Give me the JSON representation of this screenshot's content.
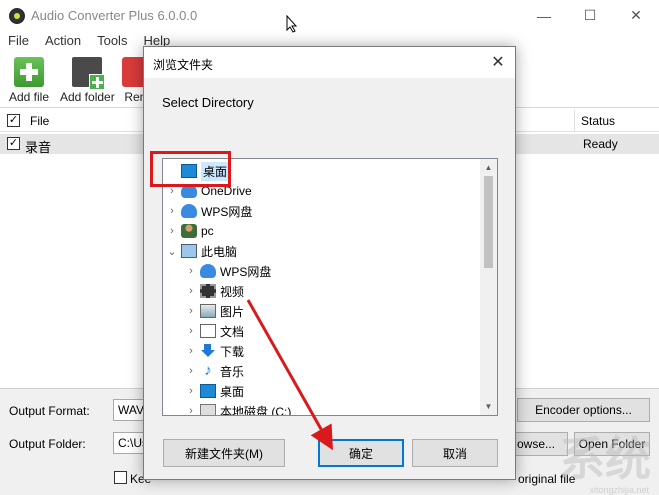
{
  "app": {
    "title": "Audio Converter Plus 6.0.0.0",
    "controls": {
      "minimize": "—",
      "maximize": "☐",
      "close": "✕"
    }
  },
  "menu": [
    "File",
    "Action",
    "Tools",
    "Help"
  ],
  "toolbar": {
    "add_file": "Add file",
    "add_folder": "Add folder",
    "remove": "Rem"
  },
  "list": {
    "header_file": "File",
    "header_status": "Status",
    "rows": [
      {
        "name": "录音",
        "status": "Ready",
        "checked": true
      }
    ]
  },
  "bottom": {
    "output_format_label": "Output Format:",
    "output_format_value": "WAV",
    "output_folder_label": "Output Folder:",
    "output_folder_value": "C:\\Us",
    "encoder_options": "Encoder options...",
    "browse": "owse...",
    "open_folder": "Open Folder",
    "keep_label": "Kee",
    "original_file_label": "original file"
  },
  "dialog": {
    "title": "浏览文件夹",
    "subtitle": "Select Directory",
    "tree": [
      {
        "label": "桌面",
        "icon": "monitor-icon",
        "selected": true
      },
      {
        "label": "OneDrive",
        "icon": "cloud-icon"
      },
      {
        "label": "WPS网盘",
        "icon": "cloud-icon"
      },
      {
        "label": "pc",
        "icon": "user-icon"
      },
      {
        "label": "此电脑",
        "icon": "computer-icon"
      },
      {
        "label": "WPS网盘",
        "icon": "cloud-icon"
      },
      {
        "label": "视频",
        "icon": "video-icon"
      },
      {
        "label": "图片",
        "icon": "picture-icon"
      },
      {
        "label": "文档",
        "icon": "document-icon"
      },
      {
        "label": "下载",
        "icon": "download-icon"
      },
      {
        "label": "音乐",
        "icon": "music-icon"
      },
      {
        "label": "桌面",
        "icon": "monitor-icon"
      },
      {
        "label": "本地磁盘 (C:)",
        "icon": "disk-icon"
      }
    ],
    "new_folder": "新建文件夹(M)",
    "ok": "确定",
    "cancel": "取消",
    "close": "✕"
  },
  "watermark": {
    "text": "系统",
    "url": "xitongzhijia.net"
  },
  "colors": {
    "selection": "#cce8ff",
    "annotation": "#d9191c",
    "accent": "#0078d7"
  }
}
